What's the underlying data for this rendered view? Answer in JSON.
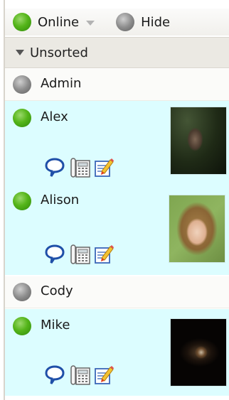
{
  "toolbar": {
    "status_label": "Online",
    "status_color": "#55b51a",
    "hide_label": "Hide",
    "hide_color": "#8d8d8d"
  },
  "group": {
    "label": "Unsorted"
  },
  "contacts": [
    {
      "name": "Admin",
      "status": "offline",
      "has_avatar": false
    },
    {
      "name": "Alex",
      "status": "online",
      "has_avatar": true
    },
    {
      "name": "Alison",
      "status": "online",
      "has_avatar": true
    },
    {
      "name": "Cody",
      "status": "offline",
      "has_avatar": false
    },
    {
      "name": "Mike",
      "status": "online",
      "has_avatar": true
    }
  ],
  "icons": {
    "status_online": "green-dot-icon",
    "status_offline": "gray-dot-icon",
    "group_toggle": "triangle-down-icon",
    "dropdown": "caret-down-icon",
    "chat": "speech-bubble-icon",
    "phone": "phone-icon",
    "note": "note-pencil-icon"
  },
  "colors": {
    "online_row_bg": "#dcfdff",
    "offline_row_bg": "#fbfbf9",
    "group_bg": "#ebe9e3",
    "chat_icon": "#1f4fa8"
  }
}
